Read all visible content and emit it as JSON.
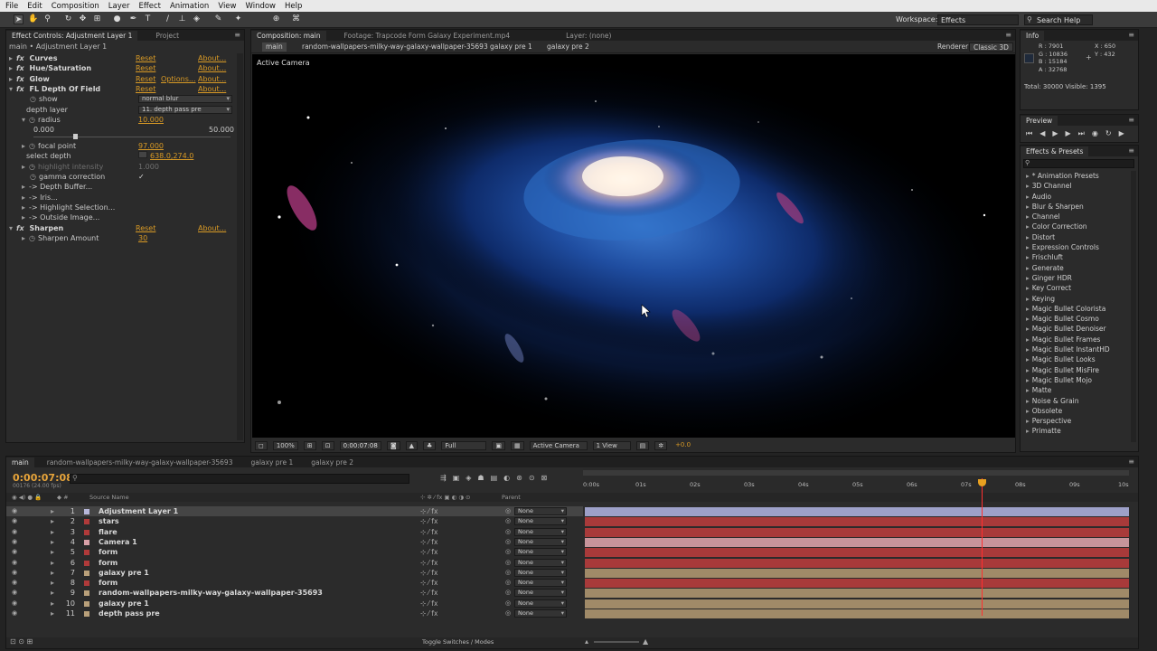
{
  "menu": [
    "File",
    "Edit",
    "Composition",
    "Layer",
    "Effect",
    "Animation",
    "View",
    "Window",
    "Help"
  ],
  "toolbar": {
    "workspace_label": "Workspace:",
    "workspace_value": "Effects",
    "search_placeholder": "Search Help"
  },
  "effect_controls": {
    "tabs": [
      "Effect Controls: Adjustment Layer 1",
      "Project"
    ],
    "breadcrumb": "main • Adjustment Layer 1",
    "effects": [
      {
        "name": "Curves",
        "reset": "Reset",
        "about": "About..."
      },
      {
        "name": "Hue/Saturation",
        "reset": "Reset",
        "about": "About..."
      },
      {
        "name": "Glow",
        "reset": "Reset",
        "options": "Options...",
        "about": "About..."
      },
      {
        "name": "FL Depth Of Field",
        "reset": "Reset",
        "about": "About..."
      },
      {
        "name": "Sharpen",
        "reset": "Reset",
        "about": "About..."
      }
    ],
    "dof": {
      "show_label": "show",
      "show_value": "normal blur",
      "depth_layer_label": "depth layer",
      "depth_layer_value": "11. depth pass pre",
      "radius_label": "radius",
      "radius_value": "10.000",
      "radius_min": "0.000",
      "radius_max": "50.000",
      "focal_point_label": "focal point",
      "focal_point_value": "97.000",
      "select_depth_label": "select depth",
      "select_depth_value": "638.0,274.0",
      "highlight_intensity_label": "highlight intensity",
      "highlight_intensity_value": "1.000",
      "gamma_label": "gamma correction",
      "subgroups": [
        "-> Depth Buffer...",
        "-> Iris...",
        "-> Highlight Selection...",
        "-> Outside Image..."
      ]
    },
    "sharpen": {
      "amount_label": "Sharpen Amount",
      "amount_value": "30"
    }
  },
  "composition": {
    "tabs": [
      "Composition: main",
      "Footage: Trapcode Form Galaxy Experiment.mp4",
      "Layer: (none)"
    ],
    "crumbs": [
      "main",
      "random-wallpapers-milky-way-galaxy-wallpaper-35693",
      "galaxy pre 1",
      "galaxy pre 2"
    ],
    "renderer_label": "Renderer:",
    "renderer_value": "Classic 3D",
    "camera_label": "Active Camera",
    "zoom": "100%",
    "timecode": "0:00:07:08",
    "resolution": "Full",
    "view_camera": "Active Camera",
    "view_count": "1 View",
    "exposure": "+0.0"
  },
  "info": {
    "tab": "Info",
    "r": "R : 7901",
    "g": "G : 10836",
    "b": "B : 15184",
    "a": "A : 32768",
    "x": "X : 650",
    "y": "Y : 432",
    "totals": "Total: 30000  Visible: 1395",
    "color": "#1f2a3b"
  },
  "preview": {
    "tab": "Preview"
  },
  "presets": {
    "tab": "Effects & Presets",
    "items": [
      "* Animation Presets",
      "3D Channel",
      "Audio",
      "Blur & Sharpen",
      "Channel",
      "Color Correction",
      "Distort",
      "Expression Controls",
      "Frischluft",
      "Generate",
      "Ginger HDR",
      "Key Correct",
      "Keying",
      "Magic Bullet Colorista",
      "Magic Bullet Cosmo",
      "Magic Bullet Denoiser",
      "Magic Bullet Frames",
      "Magic Bullet InstantHD",
      "Magic Bullet Looks",
      "Magic Bullet MisFire",
      "Magic Bullet Mojo",
      "Matte",
      "Noise & Grain",
      "Obsolete",
      "Perspective",
      "Primatte"
    ]
  },
  "timeline": {
    "tabs": [
      "main",
      "random-wallpapers-milky-way-galaxy-wallpaper-35693",
      "galaxy pre 1",
      "galaxy pre 2"
    ],
    "timecode": "0:00:07:08",
    "fps": "00176 (24.00 fps)",
    "source_name_label": "Source Name",
    "parent_label": "Parent",
    "toggle_label": "Toggle Switches / Modes",
    "ticks": [
      "0:00s",
      "01s",
      "02s",
      "03s",
      "04s",
      "05s",
      "06s",
      "07s",
      "08s",
      "09s",
      "10s"
    ],
    "layers": [
      {
        "num": "1",
        "name": "Adjustment Layer 1",
        "color": "#b7b7d9",
        "bar": "#9da0c8",
        "parent": "None"
      },
      {
        "num": "2",
        "name": "stars",
        "color": "#b03a3a",
        "bar": "#a83a3a",
        "parent": "None"
      },
      {
        "num": "3",
        "name": "flare",
        "color": "#b03a3a",
        "bar": "#a83a3a",
        "parent": "None"
      },
      {
        "num": "4",
        "name": "Camera 1",
        "color": "#d9a0a8",
        "bar": "#c7949b",
        "parent": "None"
      },
      {
        "num": "5",
        "name": "form",
        "color": "#b03a3a",
        "bar": "#a83a3a",
        "parent": "None"
      },
      {
        "num": "6",
        "name": "form",
        "color": "#b03a3a",
        "bar": "#a83a3a",
        "parent": "None"
      },
      {
        "num": "7",
        "name": "galaxy pre 1",
        "color": "#b9a07a",
        "bar": "#a08a68",
        "parent": "None"
      },
      {
        "num": "8",
        "name": "form",
        "color": "#b03a3a",
        "bar": "#a83a3a",
        "parent": "None"
      },
      {
        "num": "9",
        "name": "random-wallpapers-milky-way-galaxy-wallpaper-35693",
        "color": "#b9a07a",
        "bar": "#a08a68",
        "parent": "None"
      },
      {
        "num": "10",
        "name": "galaxy pre 1",
        "color": "#b9a07a",
        "bar": "#a08a68",
        "parent": "None"
      },
      {
        "num": "11",
        "name": "depth pass pre",
        "color": "#b9a07a",
        "bar": "#a08a68",
        "parent": "None"
      }
    ]
  }
}
